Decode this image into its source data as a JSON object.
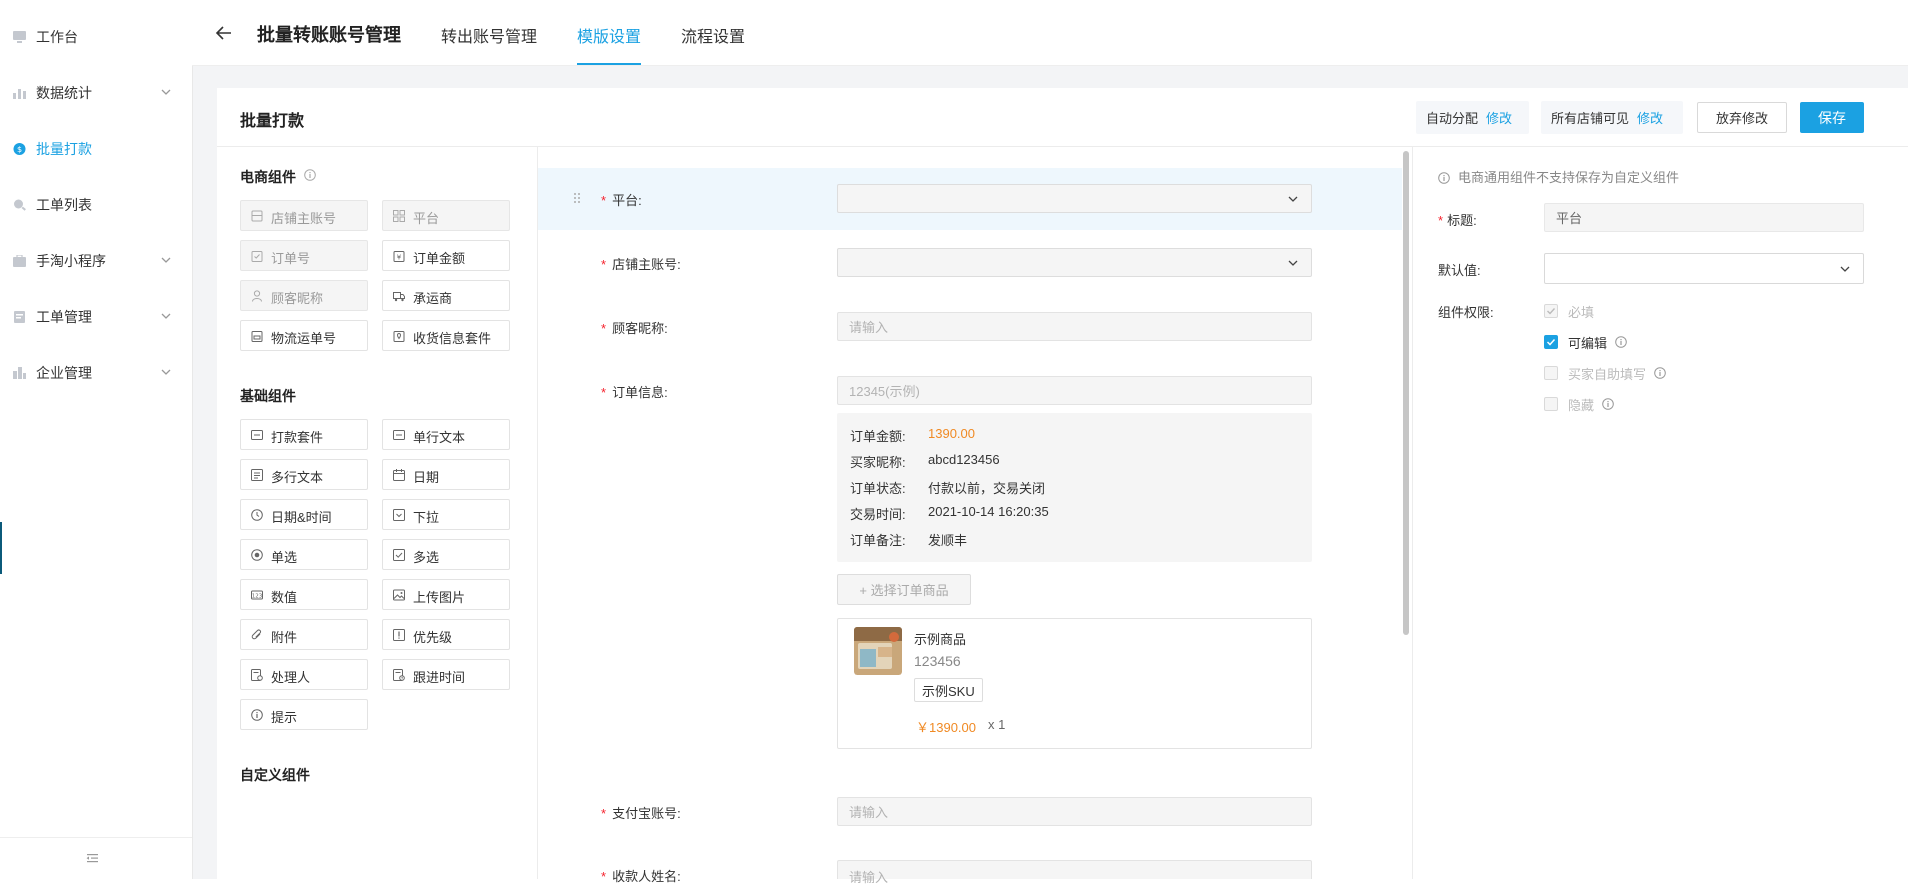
{
  "sidebar": {
    "items": [
      {
        "label": "工作台"
      },
      {
        "label": "数据统计"
      },
      {
        "label": "批量打款"
      },
      {
        "label": "工单列表"
      },
      {
        "label": "手淘小程序"
      },
      {
        "label": "工单管理"
      },
      {
        "label": "企业管理"
      }
    ],
    "active_index": 2
  },
  "header": {
    "title": "批量转账账号管理",
    "tabs": [
      {
        "label": "转出账号管理"
      },
      {
        "label": "模版设置"
      },
      {
        "label": "流程设置"
      }
    ],
    "active_tab": 1
  },
  "panel": {
    "title": "批量打款",
    "auto_assign_label": "自动分配",
    "auto_assign_link": "修改",
    "visibility_label": "所有店铺可见",
    "visibility_link": "修改",
    "discard_label": "放弃修改",
    "save_label": "保存"
  },
  "palette": {
    "ecommerce_title": "电商组件",
    "ecommerce": [
      {
        "label": "店铺主账号",
        "icon": "store-icon",
        "disabled": true
      },
      {
        "label": "平台",
        "icon": "grid-icon",
        "disabled": true
      },
      {
        "label": "订单号",
        "icon": "clipboard-icon",
        "disabled": true
      },
      {
        "label": "订单金额",
        "icon": "amount-icon",
        "disabled": false
      },
      {
        "label": "顾客昵称",
        "icon": "user-icon",
        "disabled": true
      },
      {
        "label": "承运商",
        "icon": "truck-icon",
        "disabled": false
      },
      {
        "label": "物流运单号",
        "icon": "package-icon",
        "disabled": false
      },
      {
        "label": "收货信息套件",
        "icon": "address-icon",
        "disabled": false
      }
    ],
    "basic_title": "基础组件",
    "basic": [
      {
        "label": "打款套件",
        "icon": "wallet-icon"
      },
      {
        "label": "单行文本",
        "icon": "single-line-icon"
      },
      {
        "label": "多行文本",
        "icon": "multi-line-icon"
      },
      {
        "label": "日期",
        "icon": "calendar-icon"
      },
      {
        "label": "日期&时间",
        "icon": "clock-icon"
      },
      {
        "label": "下拉",
        "icon": "dropdown-icon"
      },
      {
        "label": "单选",
        "icon": "radio-icon"
      },
      {
        "label": "多选",
        "icon": "checkbox-icon"
      },
      {
        "label": "数值",
        "icon": "number-icon"
      },
      {
        "label": "上传图片",
        "icon": "image-icon"
      },
      {
        "label": "附件",
        "icon": "attachment-icon"
      },
      {
        "label": "优先级",
        "icon": "priority-icon"
      },
      {
        "label": "处理人",
        "icon": "handler-icon"
      },
      {
        "label": "跟进时间",
        "icon": "follow-time-icon"
      },
      {
        "label": "提示",
        "icon": "tip-icon"
      }
    ],
    "custom_title": "自定义组件"
  },
  "form": {
    "platform_label": "平台:",
    "store_label": "店铺主账号:",
    "nickname_label": "顾客昵称:",
    "nickname_placeholder": "请输入",
    "order_label": "订单信息:",
    "order_placeholder": "12345(示例)",
    "order_details": [
      {
        "key": "订单金额:",
        "value": "1390.00",
        "highlight": true
      },
      {
        "key": "买家昵称:",
        "value": "abcd123456",
        "highlight": false
      },
      {
        "key": "订单状态:",
        "value": "付款以前，交易关闭",
        "highlight": false
      },
      {
        "key": "交易时间:",
        "value": "2021-10-14 16:20:35",
        "highlight": false
      },
      {
        "key": "订单备注:",
        "value": "发顺丰",
        "highlight": false
      }
    ],
    "pick_goods_label": "+ 选择订单商品",
    "goods": {
      "name": "示例商品",
      "id": "123456",
      "sku": "示例SKU",
      "price": "￥1390.00",
      "qty": "x 1"
    },
    "alipay_label": "支付宝账号:",
    "alipay_placeholder": "请输入",
    "payee_label": "收款人姓名:",
    "payee_placeholder": "请输入"
  },
  "props": {
    "note": "电商通用组件不支持保存为自定义组件",
    "title_label": "标题:",
    "title_value": "平台",
    "default_label": "默认值:",
    "permission_label": "组件权限:",
    "permissions": [
      {
        "label": "必填",
        "checked": true,
        "enabled": false,
        "info": false
      },
      {
        "label": "可编辑",
        "checked": true,
        "enabled": true,
        "info": true
      },
      {
        "label": "买家自助填写",
        "checked": false,
        "enabled": false,
        "info": true
      },
      {
        "label": "隐藏",
        "checked": false,
        "enabled": false,
        "info": true
      }
    ]
  },
  "colors": {
    "accent": "#1ba1e2",
    "required": "#f5222d",
    "price": "#f08a24"
  }
}
